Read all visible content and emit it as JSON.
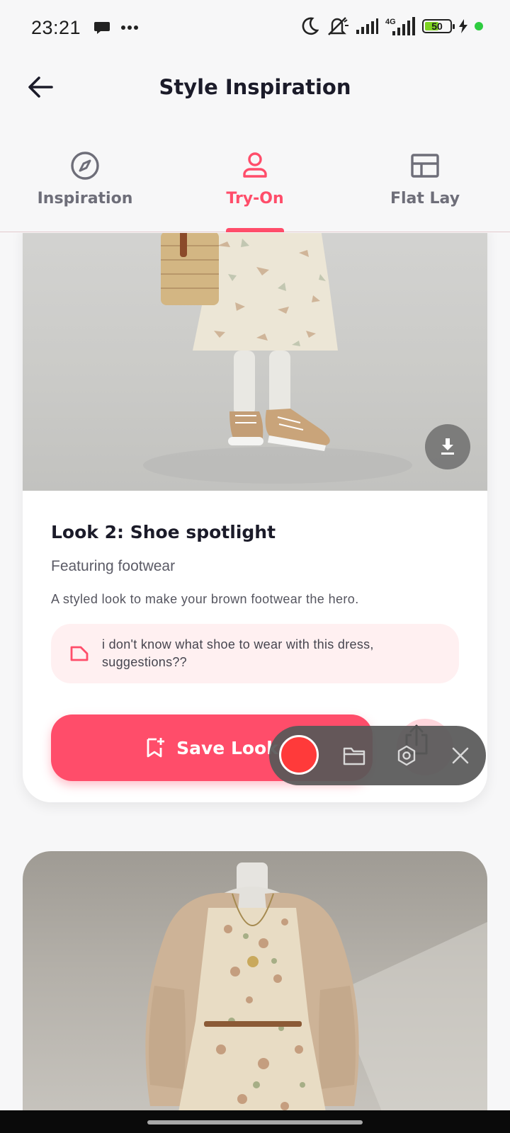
{
  "status_bar": {
    "time": "23:21",
    "left_icons": [
      "message-icon",
      "more-dots-icon"
    ],
    "right_icons": [
      "moon-icon",
      "mute-icon",
      "signal-icon",
      "signal-4g-icon",
      "battery-icon",
      "charging-icon"
    ],
    "network_label": "4G",
    "battery_level": "50"
  },
  "app_bar": {
    "title": "Style Inspiration",
    "back_icon": "arrow-left-icon"
  },
  "tabs": [
    {
      "label": "Inspiration",
      "icon": "compass-icon",
      "active": false
    },
    {
      "label": "Try-On",
      "icon": "person-icon",
      "active": true
    },
    {
      "label": "Flat Lay",
      "icon": "layout-icon",
      "active": false
    }
  ],
  "look_card": {
    "title": "Look 2: Shoe spotlight",
    "subtitle": "Featuring footwear",
    "description": "A styled look to make your brown footwear the hero.",
    "prompt": "i don't know what shoe to wear with this dress, suggestions??",
    "save_label": "Save Look",
    "download_icon": "download-icon",
    "save_icon": "bookmark-add-icon",
    "share_icon": "share-icon"
  },
  "recorder": {
    "icons": [
      "record-icon",
      "folder-icon",
      "settings-icon",
      "close-icon"
    ]
  },
  "colors": {
    "accent": "#ff4d6a",
    "prompt_bg": "#fff0f1",
    "text_dark": "#1b1b29",
    "text_muted": "#6e6e79"
  }
}
